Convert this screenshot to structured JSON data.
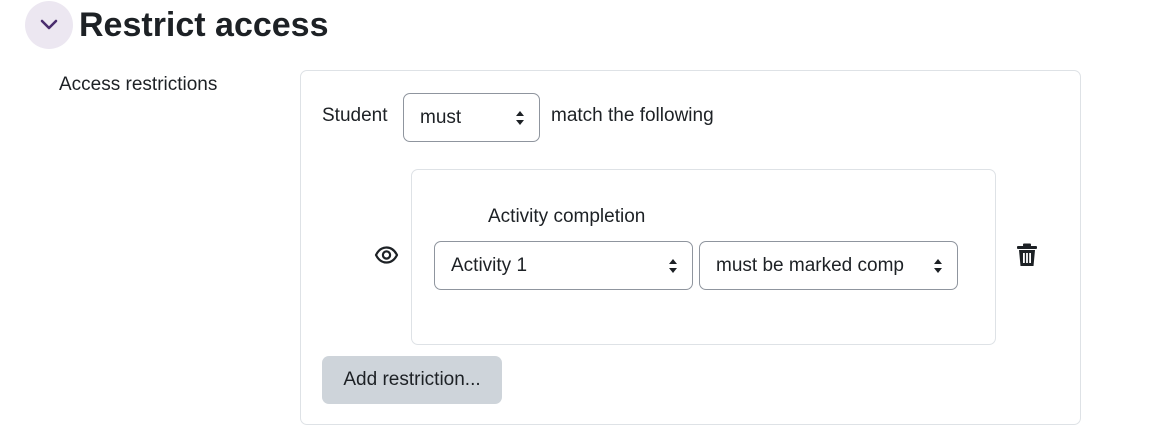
{
  "section": {
    "title": "Restrict access",
    "collapse_icon": "chevron-down-icon"
  },
  "field": {
    "label": "Access restrictions"
  },
  "restriction_set": {
    "student_label": "Student",
    "must_select_value": "must",
    "match_label": "match the following"
  },
  "condition": {
    "type_label": "Activity completion",
    "activity_value": "Activity 1",
    "completion_value": "must be marked comp",
    "visibility_icon": "eye-icon",
    "delete_icon": "trash-icon"
  },
  "actions": {
    "add_restriction_label": "Add restriction..."
  },
  "colors": {
    "accent": "#4a2d6e",
    "collapse_bg": "#ece7f1",
    "button_bg": "#ced4da",
    "border": "#dee2e6",
    "select_border": "#8f959e",
    "text": "#1d2125"
  }
}
